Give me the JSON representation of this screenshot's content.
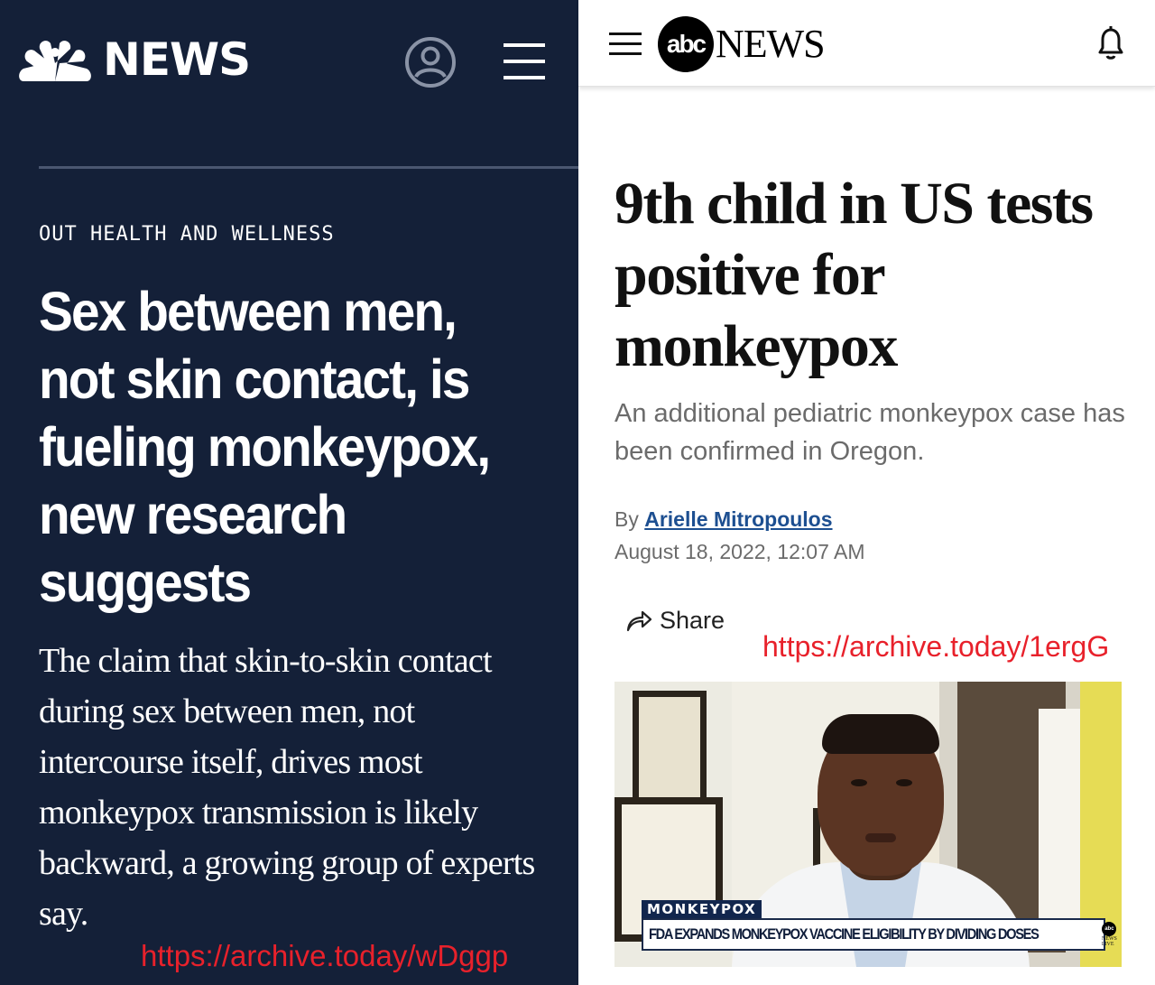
{
  "nbc": {
    "logo_text": "NEWS",
    "section_label": "OUT HEALTH AND WELLNESS",
    "headline": "Sex between men, not skin contact, is fueling monkeypox, new research suggests",
    "summary": "The claim that skin-to-skin contact during sex between men, not intercourse itself, drives most monkeypox transmission is likely backward, a growing group of experts say.",
    "archive_link": "https://archive.today/wDggp",
    "icons": [
      "peacock-logo-icon",
      "account-icon",
      "hamburger-menu-icon"
    ],
    "colors": {
      "background": "#142038",
      "text": "#ffffff",
      "archive_link": "#e8212b"
    }
  },
  "abc": {
    "logo_circle_text": "abc",
    "logo_text": "NEWS",
    "headline": "9th child in US tests positive for monkeypox",
    "summary": "An additional pediatric monkeypox case has been confirmed in Oregon.",
    "byline_prefix": "By",
    "author": "Arielle Mitropoulos",
    "date": "August 18, 2022, 12:07 AM",
    "share_label": "Share",
    "archive_link": "https://archive.today/1ergG",
    "video": {
      "tag_part1": "MONKEY",
      "tag_part2": "POX",
      "chyron": "FDA EXPANDS MONKEYPOX VACCINE ELIGIBILITY BY DIVIDING DOSES",
      "mini_logo_circle": "abc",
      "mini_logo_text": "NEWS LIVE"
    },
    "icons": [
      "hamburger-menu-icon",
      "notification-bell-icon",
      "share-arrow-icon"
    ],
    "colors": {
      "author_link": "#1d4f91",
      "summary_text": "#6b6b6b",
      "archive_link": "#e8212b"
    }
  }
}
